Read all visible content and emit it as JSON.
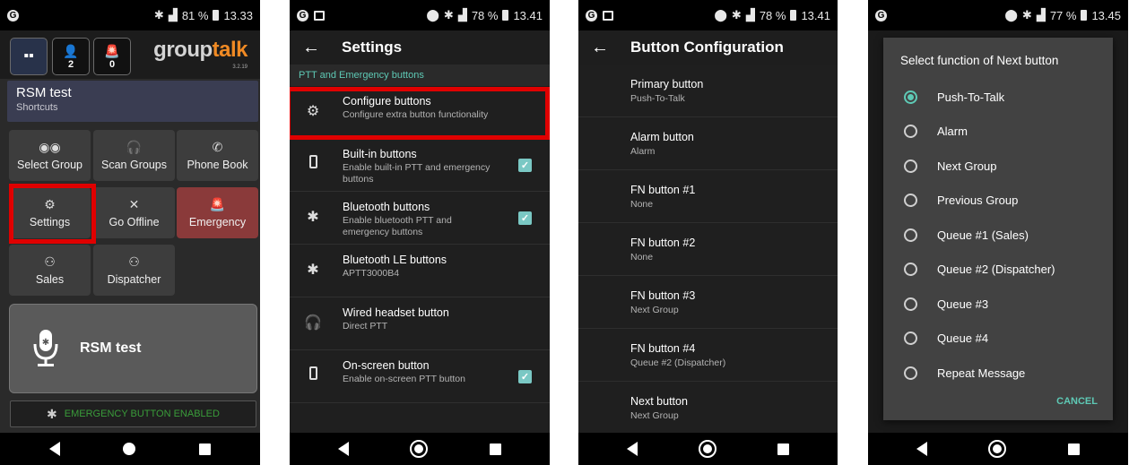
{
  "screen1": {
    "status": {
      "battery": "81 %",
      "time": "13.33"
    },
    "header": {
      "user_count": "2",
      "alarm_count": "0",
      "logo_group": "group",
      "logo_talk": "talk",
      "version": "3.2.19"
    },
    "profile": {
      "title": "RSM test",
      "subtitle": "Shortcuts"
    },
    "shortcuts": [
      {
        "label": "Select Group",
        "icon": "group-icon"
      },
      {
        "label": "Scan Groups",
        "icon": "headphones-icon"
      },
      {
        "label": "Phone Book",
        "icon": "phone-icon"
      },
      {
        "label": "Settings",
        "icon": "gear-icon"
      },
      {
        "label": "Go Offline",
        "icon": "close-icon"
      },
      {
        "label": "Emergency",
        "icon": "alarm-icon"
      },
      {
        "label": "Sales",
        "icon": "group-call-icon"
      },
      {
        "label": "Dispatcher",
        "icon": "group-call-icon"
      }
    ],
    "ptt_label": "RSM test",
    "emergency_status": "EMERGENCY BUTTON ENABLED",
    "highlight_color": "#e00000"
  },
  "screen2": {
    "status": {
      "battery": "78 %",
      "time": "13.41"
    },
    "title": "Settings",
    "section": "PTT and Emergency buttons",
    "rows": [
      {
        "title": "Configure buttons",
        "subtitle": "Configure extra button functionality",
        "icon": "gear-icon"
      },
      {
        "title": "Built-in buttons",
        "subtitle": "Enable built-in PTT and emergency buttons",
        "icon": "phone-device-icon",
        "checked": true
      },
      {
        "title": "Bluetooth buttons",
        "subtitle": "Enable bluetooth PTT and emergency buttons",
        "icon": "bluetooth-icon",
        "checked": true
      },
      {
        "title": "Bluetooth LE buttons",
        "subtitle": "APTT3000B4",
        "icon": "bluetooth-icon"
      },
      {
        "title": "Wired headset button",
        "subtitle": "Direct PTT",
        "icon": "headphones-icon"
      },
      {
        "title": "On-screen button",
        "subtitle": "Enable on-screen PTT button",
        "icon": "phone-device-icon",
        "checked": true
      }
    ]
  },
  "screen3": {
    "status": {
      "battery": "78 %",
      "time": "13.41"
    },
    "title": "Button Configuration",
    "rows": [
      {
        "title": "Primary button",
        "value": "Push-To-Talk"
      },
      {
        "title": "Alarm button",
        "value": "Alarm"
      },
      {
        "title": "FN button #1",
        "value": "None"
      },
      {
        "title": "FN button #2",
        "value": "None"
      },
      {
        "title": "FN button #3",
        "value": "Next Group"
      },
      {
        "title": "FN button #4",
        "value": "Queue #2 (Dispatcher)"
      },
      {
        "title": "Next button",
        "value": "Next Group"
      }
    ]
  },
  "screen4": {
    "status": {
      "battery": "77 %",
      "time": "13.45"
    },
    "dialog_title": "Select function of Next button",
    "options": [
      {
        "label": "Push-To-Talk",
        "selected": true
      },
      {
        "label": "Alarm",
        "selected": false
      },
      {
        "label": "Next Group",
        "selected": false
      },
      {
        "label": "Previous Group",
        "selected": false
      },
      {
        "label": "Queue #1 (Sales)",
        "selected": false
      },
      {
        "label": "Queue #2 (Dispatcher)",
        "selected": false
      },
      {
        "label": "Queue #3",
        "selected": false
      },
      {
        "label": "Queue #4",
        "selected": false
      },
      {
        "label": "Repeat Message",
        "selected": false
      }
    ],
    "cancel_label": "CANCEL",
    "accent_color": "#5ec9b5"
  }
}
